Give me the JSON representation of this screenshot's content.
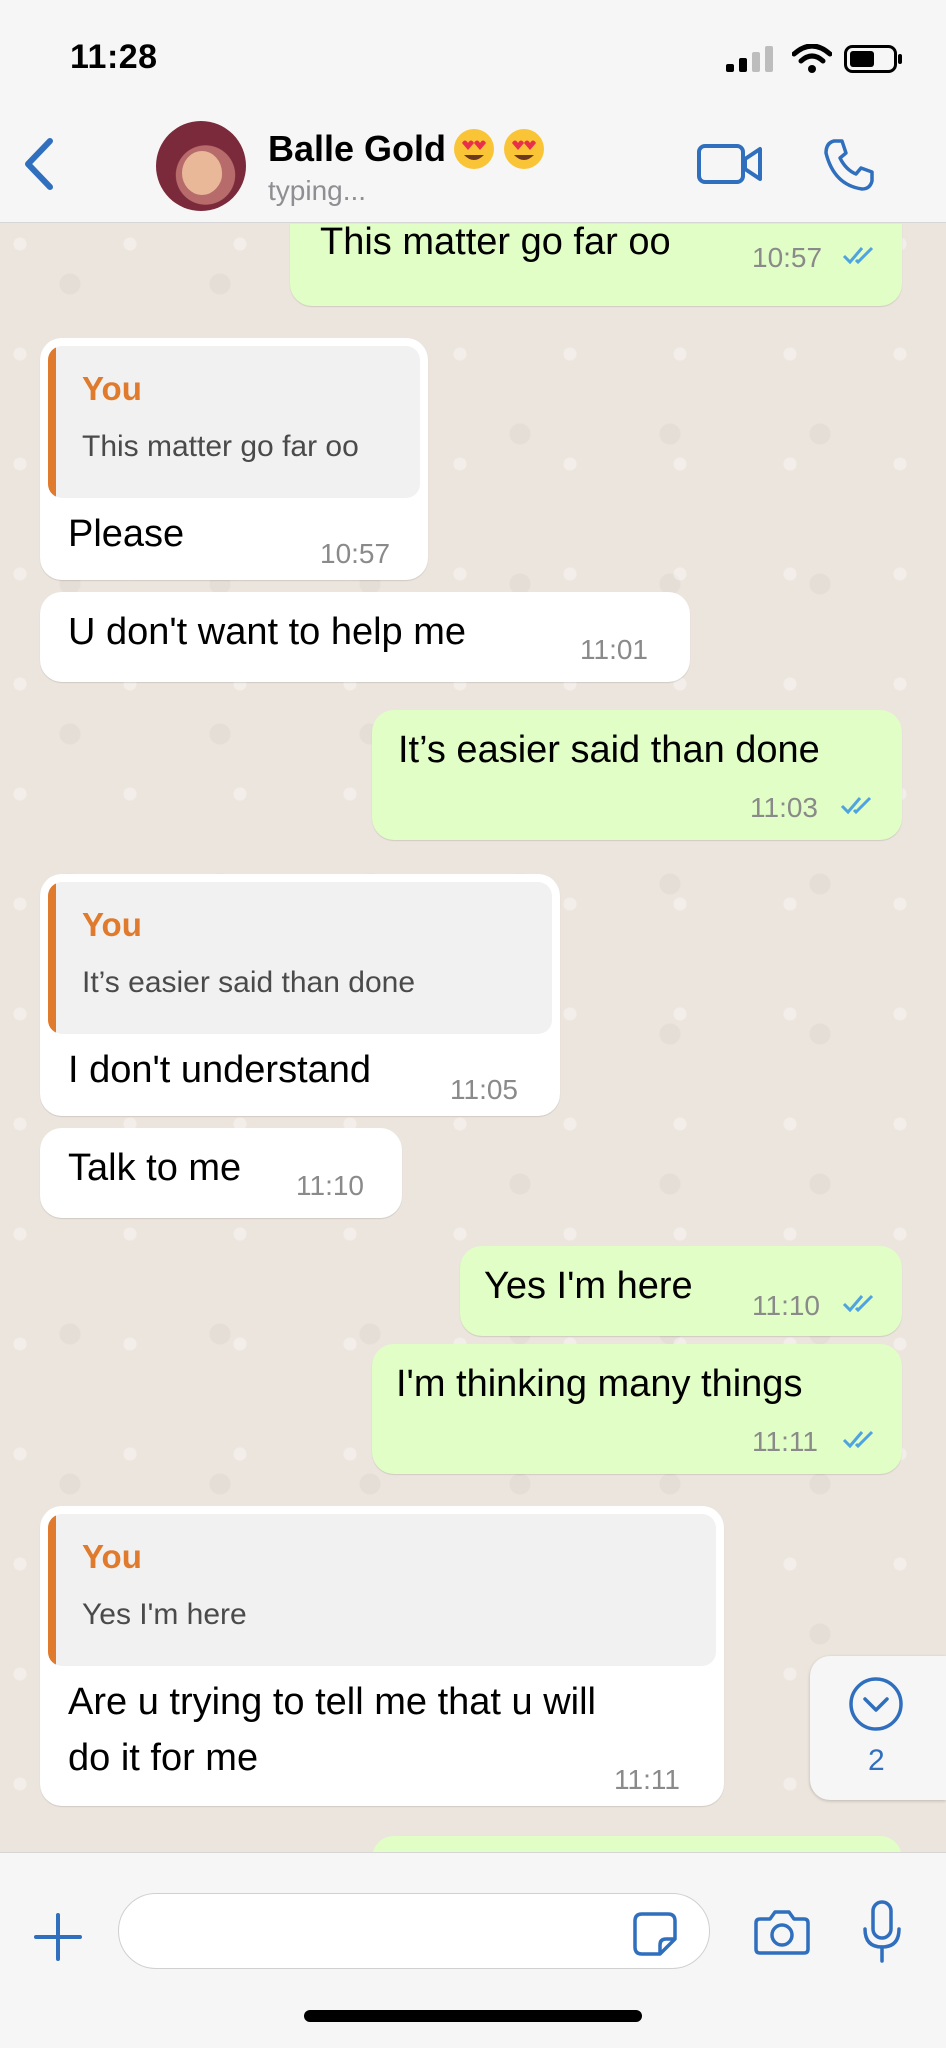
{
  "status_bar": {
    "time": "11:28"
  },
  "header": {
    "contact_name": "Balle Gold",
    "emojis": [
      "heart-eyes",
      "heart-eyes"
    ],
    "status": "typing..."
  },
  "messages": [
    {
      "dir": "out",
      "text": "This matter go far oo",
      "time": "10:57",
      "read": true
    },
    {
      "dir": "in",
      "quote_author": "You",
      "quote_text": "This matter go far oo",
      "text": "Please",
      "time": "10:57"
    },
    {
      "dir": "in",
      "text": "U don't want to help me",
      "time": "11:01"
    },
    {
      "dir": "out",
      "text": "It’s easier said than done",
      "time": "11:03",
      "read": true
    },
    {
      "dir": "in",
      "quote_author": "You",
      "quote_text": "It’s easier said than done",
      "text": "I don't understand",
      "time": "11:05"
    },
    {
      "dir": "in",
      "text": "Talk to me",
      "time": "11:10"
    },
    {
      "dir": "out",
      "text": "Yes I'm here",
      "time": "11:10",
      "read": true
    },
    {
      "dir": "out",
      "text": "I'm thinking many things",
      "time": "11:11",
      "read": true
    },
    {
      "dir": "in",
      "quote_author": "You",
      "quote_text": "Yes I'm here",
      "text_line1": "Are u trying to tell me that u will",
      "text_line2": "do it for me",
      "time": "11:11"
    }
  ],
  "scroll_down": {
    "unread_count": "2"
  },
  "input": {
    "value": "",
    "placeholder": ""
  },
  "colors": {
    "accent": "#2F6FBE",
    "outgoing_bubble": "#E1FEC6",
    "incoming_bubble": "#FFFFFF",
    "quote_author": "#E07A2C",
    "read_ticks": "#4FA3E0",
    "chat_background": "#ECE5DD"
  }
}
